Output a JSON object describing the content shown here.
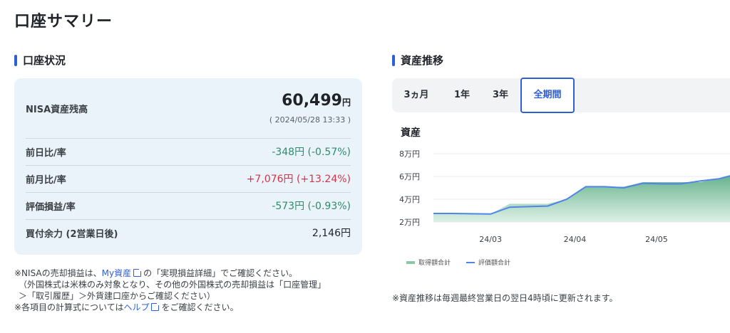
{
  "page": {
    "title": "口座サマリー"
  },
  "account": {
    "section_title": "口座状況",
    "balance_label": "NISA資産残高",
    "balance_value": "60,499",
    "balance_unit": "円",
    "balance_date": "( 2024/05/28 13:33 )",
    "rows": [
      {
        "label": "前日比/率",
        "value": "-348円 (-0.57%)",
        "tone": "green"
      },
      {
        "label": "前月比/率",
        "value": "+7,076円 (+13.24%)",
        "tone": "red"
      },
      {
        "label": "評価損益/率",
        "value": "-573円 (-0.93%)",
        "tone": "green"
      },
      {
        "label": "買付余力 (2営業日後)",
        "value": "2,146円",
        "tone": "dark"
      }
    ],
    "notes": {
      "line1_prefix": "※NISAの売却損益は、",
      "line1_link": "My資産",
      "line1_suffix": "の「実現損益詳細」でご確認ください。",
      "line2": "（外国株式は米株のみ対象となり、その他の外国株式の売却損益は「口座管理」",
      "line3": "＞「取引履歴」＞外貨建口座からご確認ください）",
      "line4_prefix": "※各項目の計算式については",
      "line4_link": "ヘルプ",
      "line4_suffix": "をご確認ください。"
    }
  },
  "trend": {
    "section_title": "資産推移",
    "tabs": [
      "3ヵ月",
      "1年",
      "3年",
      "全期間"
    ],
    "active_tab": "全期間",
    "chart_title": "資産",
    "legend_cost": "取得額合計",
    "legend_eval": "評価額合計",
    "note": "※資産推移は毎週最終営業日の翌日4時頃に更新されます。"
  },
  "colors": {
    "accent": "#2f5fd6",
    "positive_down": "#2e8b6a",
    "negative_up": "#d6334a",
    "area": "#8fc6a9",
    "line": "#4f86e6"
  },
  "chart_data": {
    "type": "area",
    "title": "資産",
    "y_ticks": [
      "8万円",
      "6万円",
      "4万円",
      "2万円"
    ],
    "ylim": [
      20000,
      80000
    ],
    "x_tick_labels": [
      "24/03",
      "24/04",
      "24/05"
    ],
    "x": [
      "2024-02-09",
      "2024-02-16",
      "2024-02-23",
      "2024-03-01",
      "2024-03-08",
      "2024-03-15",
      "2024-03-22",
      "2024-03-29",
      "2024-04-05",
      "2024-04-12",
      "2024-04-19",
      "2024-04-26",
      "2024-05-03",
      "2024-05-10",
      "2024-05-17",
      "2024-05-24",
      "2024-05-28"
    ],
    "series": [
      {
        "name": "取得額合計",
        "values": [
          27500,
          27500,
          27300,
          27000,
          36000,
          36000,
          36000,
          40000,
          51000,
          51000,
          51000,
          55000,
          55000,
          55000,
          55000,
          58000,
          61072
        ]
      },
      {
        "name": "評価額合計",
        "values": [
          27500,
          27500,
          27300,
          27000,
          33000,
          33500,
          34000,
          40000,
          51000,
          51000,
          50000,
          54000,
          53500,
          53500,
          56000,
          58000,
          60499
        ]
      }
    ]
  }
}
